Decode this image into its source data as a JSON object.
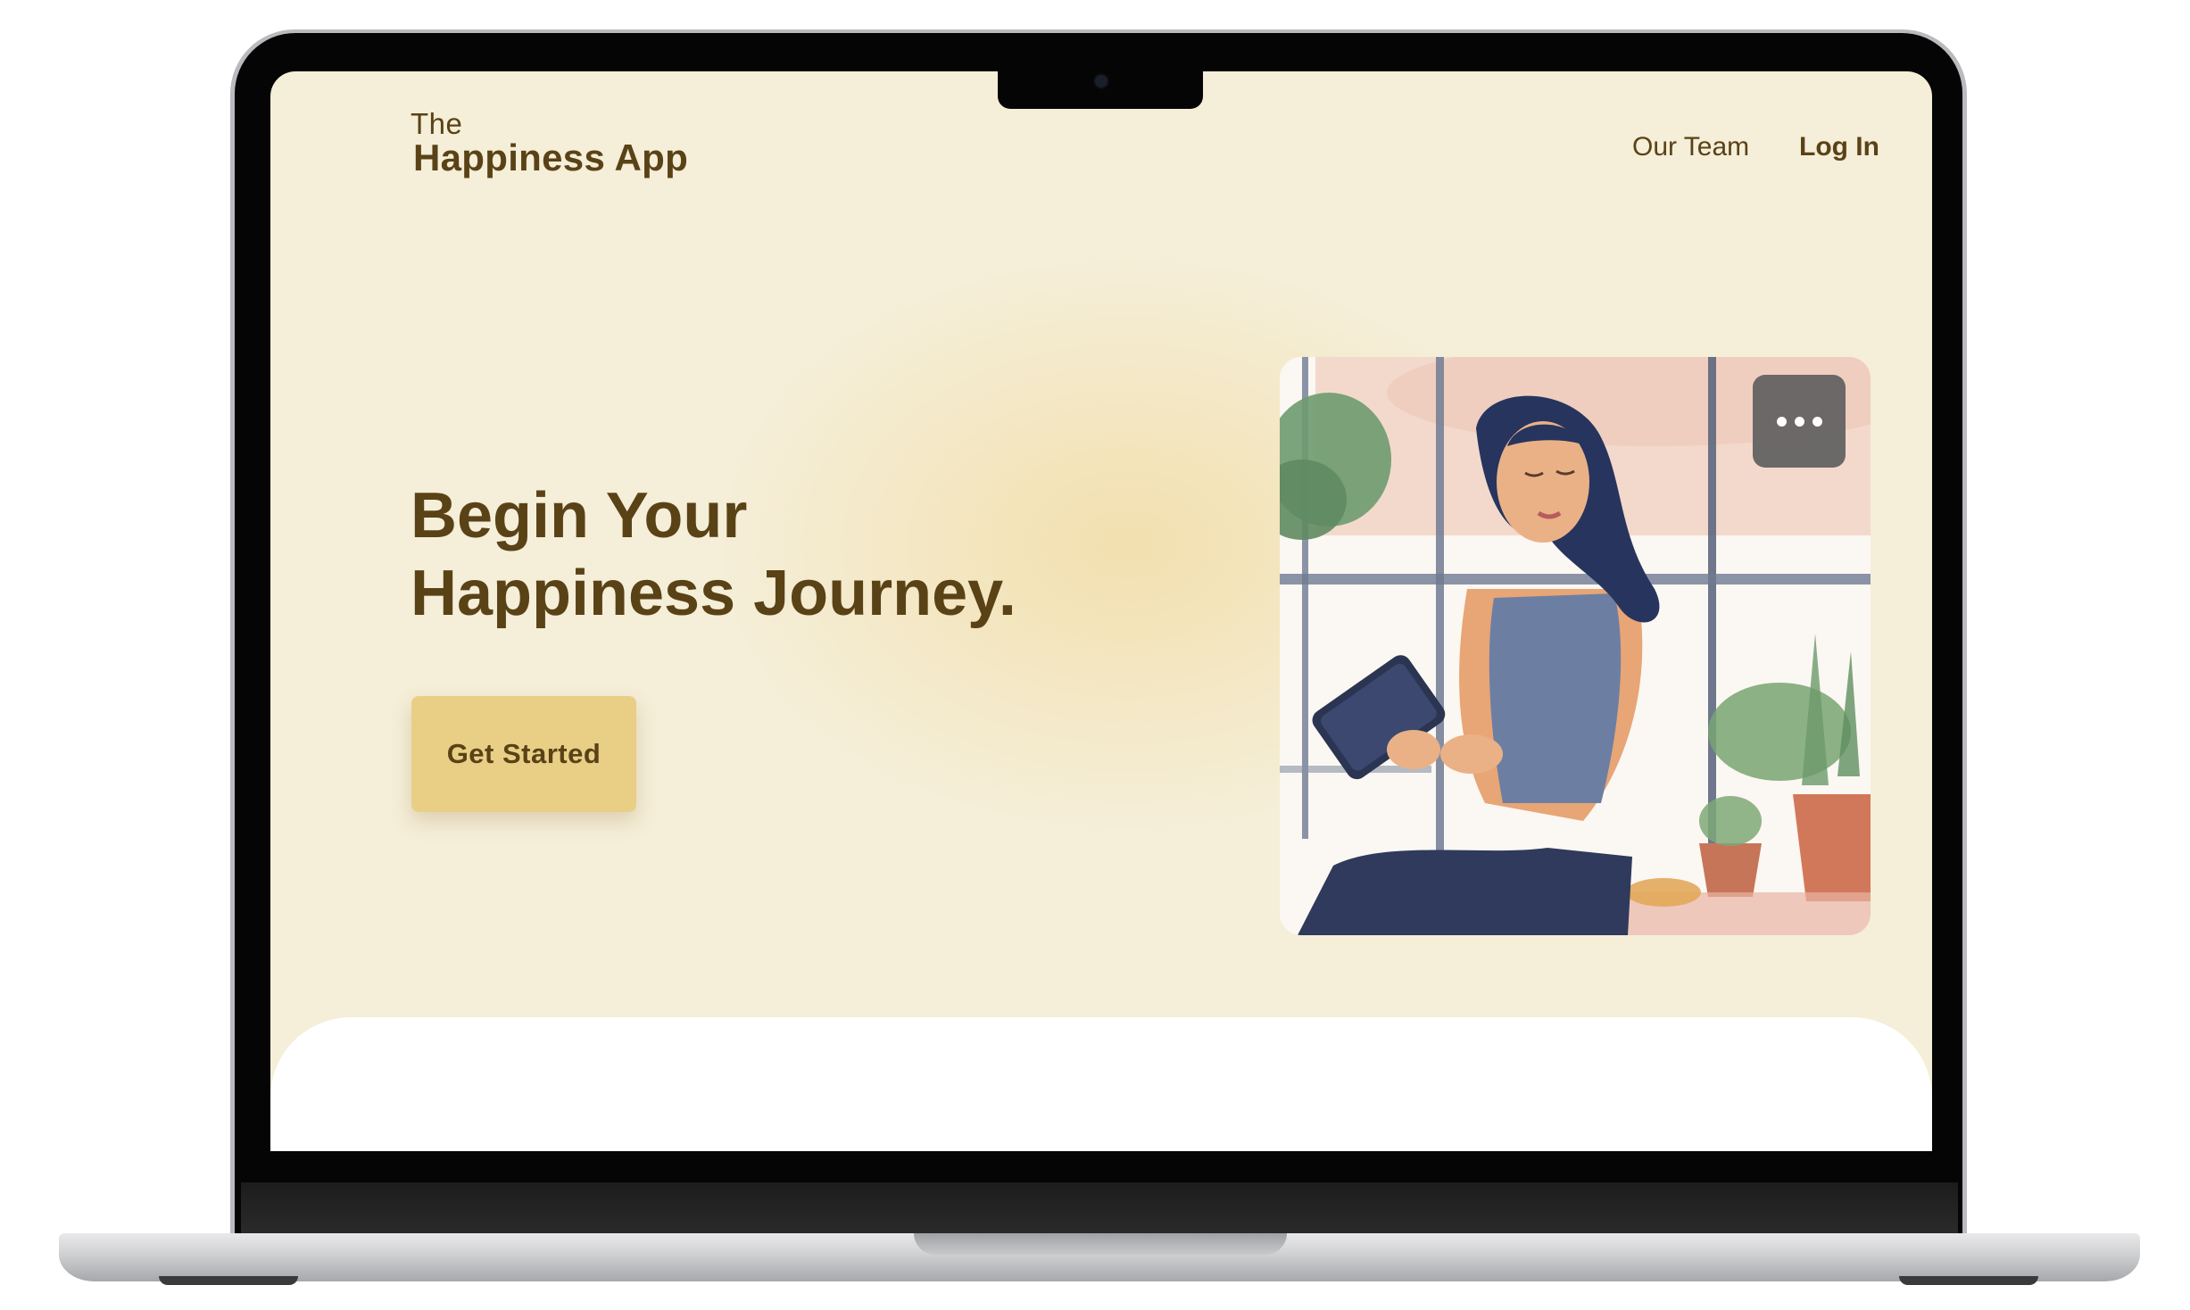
{
  "header": {
    "logo_prefix": "The",
    "logo_title": "Happiness App",
    "nav": [
      {
        "label": "Our Team"
      },
      {
        "label": "Log In"
      }
    ]
  },
  "hero": {
    "headline_line1": "Begin Your",
    "headline_line2": "Happiness Journey.",
    "cta_label": "Get Started",
    "image_alt": "woman-reading-tablet-illustration",
    "menu_icon": "more-dots-icon"
  },
  "colors": {
    "background": "#f5eed8",
    "text": "#5a4217",
    "accent": "#e9cf86"
  }
}
